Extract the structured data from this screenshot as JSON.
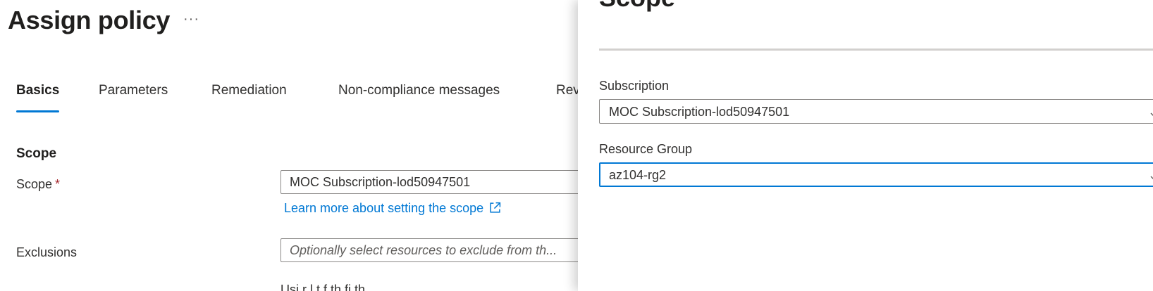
{
  "header": {
    "title": "Assign policy",
    "more_label": "···"
  },
  "tabs": [
    {
      "label": "Basics",
      "active": true
    },
    {
      "label": "Parameters",
      "active": false
    },
    {
      "label": "Remediation",
      "active": false
    },
    {
      "label": "Non-compliance messages",
      "active": false
    },
    {
      "label": "Rev",
      "active": false
    }
  ],
  "basics": {
    "section_heading": "Scope",
    "scope_label": "Scope",
    "required_mark": "*",
    "scope_value": "MOC Subscription-lod50947501",
    "learn_more_link": "Learn more about setting the scope",
    "exclusions_label": "Exclusions",
    "exclusions_placeholder": "Optionally select resources to exclude from th...",
    "partial_text": "Usi       r       l t         f th        fi   th"
  },
  "flyout": {
    "title": "Scope",
    "subscription_label": "Subscription",
    "subscription_value": "MOC Subscription-lod50947501",
    "resource_group_label": "Resource Group",
    "resource_group_value": "az104-rg2"
  },
  "colors": {
    "accent": "#0078d4",
    "required": "#a4262c",
    "border": "#8a8886"
  },
  "icons": {
    "more": "ellipsis-icon",
    "external_link": "external-link-icon",
    "dropdown": "chevron-down-icon"
  }
}
